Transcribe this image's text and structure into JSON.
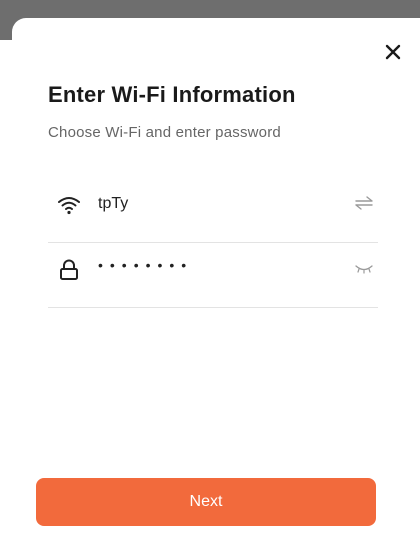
{
  "dialog": {
    "title": "Enter Wi-Fi Information",
    "subtitle": "Choose Wi-Fi and enter password",
    "close_icon": "close-icon"
  },
  "wifi": {
    "icon": "wifi-icon",
    "ssid": "tpTy",
    "switch_icon": "swap-arrows-icon"
  },
  "password": {
    "icon": "lock-icon",
    "masked_value": "••••••••",
    "toggle_icon": "eye-closed-icon"
  },
  "actions": {
    "next_label": "Next"
  },
  "colors": {
    "accent": "#f26a3c",
    "title_text": "#1a1a1a",
    "subtitle_text": "#666666",
    "divider": "#e3e3e3"
  }
}
